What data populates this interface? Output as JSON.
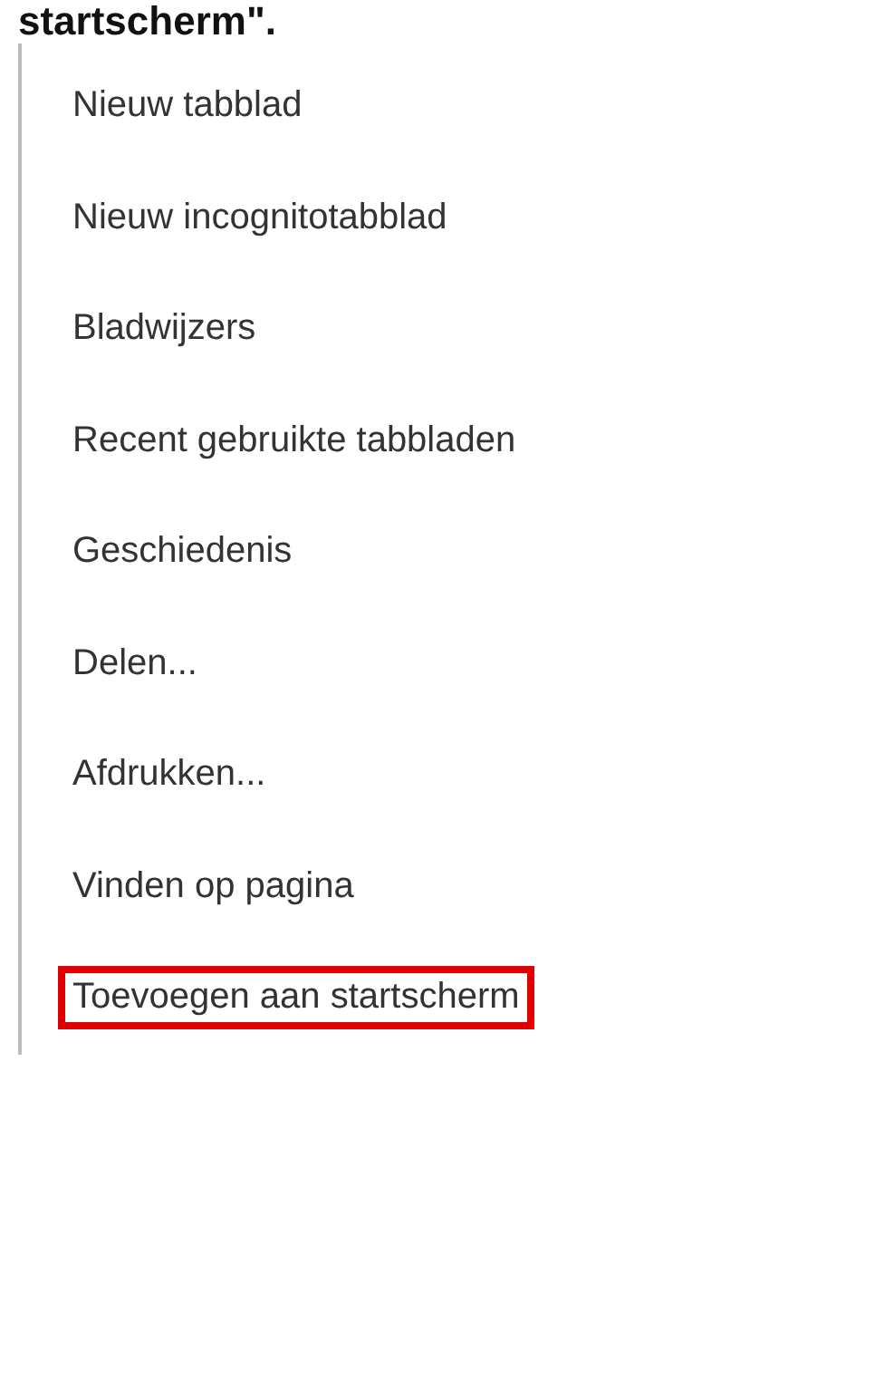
{
  "caption": "startscherm\".",
  "menu": {
    "items": [
      {
        "label": "Nieuw tabblad",
        "highlighted": false
      },
      {
        "label": "Nieuw incognitotabblad",
        "highlighted": false
      },
      {
        "label": "Bladwijzers",
        "highlighted": false
      },
      {
        "label": "Recent gebruikte tabbladen",
        "highlighted": false
      },
      {
        "label": "Geschiedenis",
        "highlighted": false
      },
      {
        "label": "Delen...",
        "highlighted": false
      },
      {
        "label": "Afdrukken...",
        "highlighted": false
      },
      {
        "label": "Vinden op pagina",
        "highlighted": false
      },
      {
        "label": "Toevoegen aan startscherm",
        "highlighted": true
      }
    ]
  }
}
